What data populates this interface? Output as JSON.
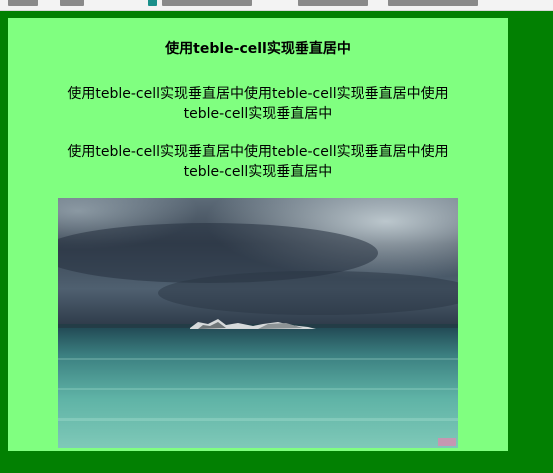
{
  "content": {
    "title": "使用teble-cell实现垂直居中",
    "paragraphs": [
      "使用teble-cell实现垂直居中使用teble-cell实现垂直居中使用teble-cell实现垂直居中",
      "使用teble-cell实现垂直居中使用teble-cell实现垂直居中使用teble-cell实现垂直居中"
    ]
  },
  "colors": {
    "page_background": "#028002",
    "cell_background": "#80ff80"
  },
  "image": {
    "subject": "stormy-sea-landscape-photo"
  }
}
